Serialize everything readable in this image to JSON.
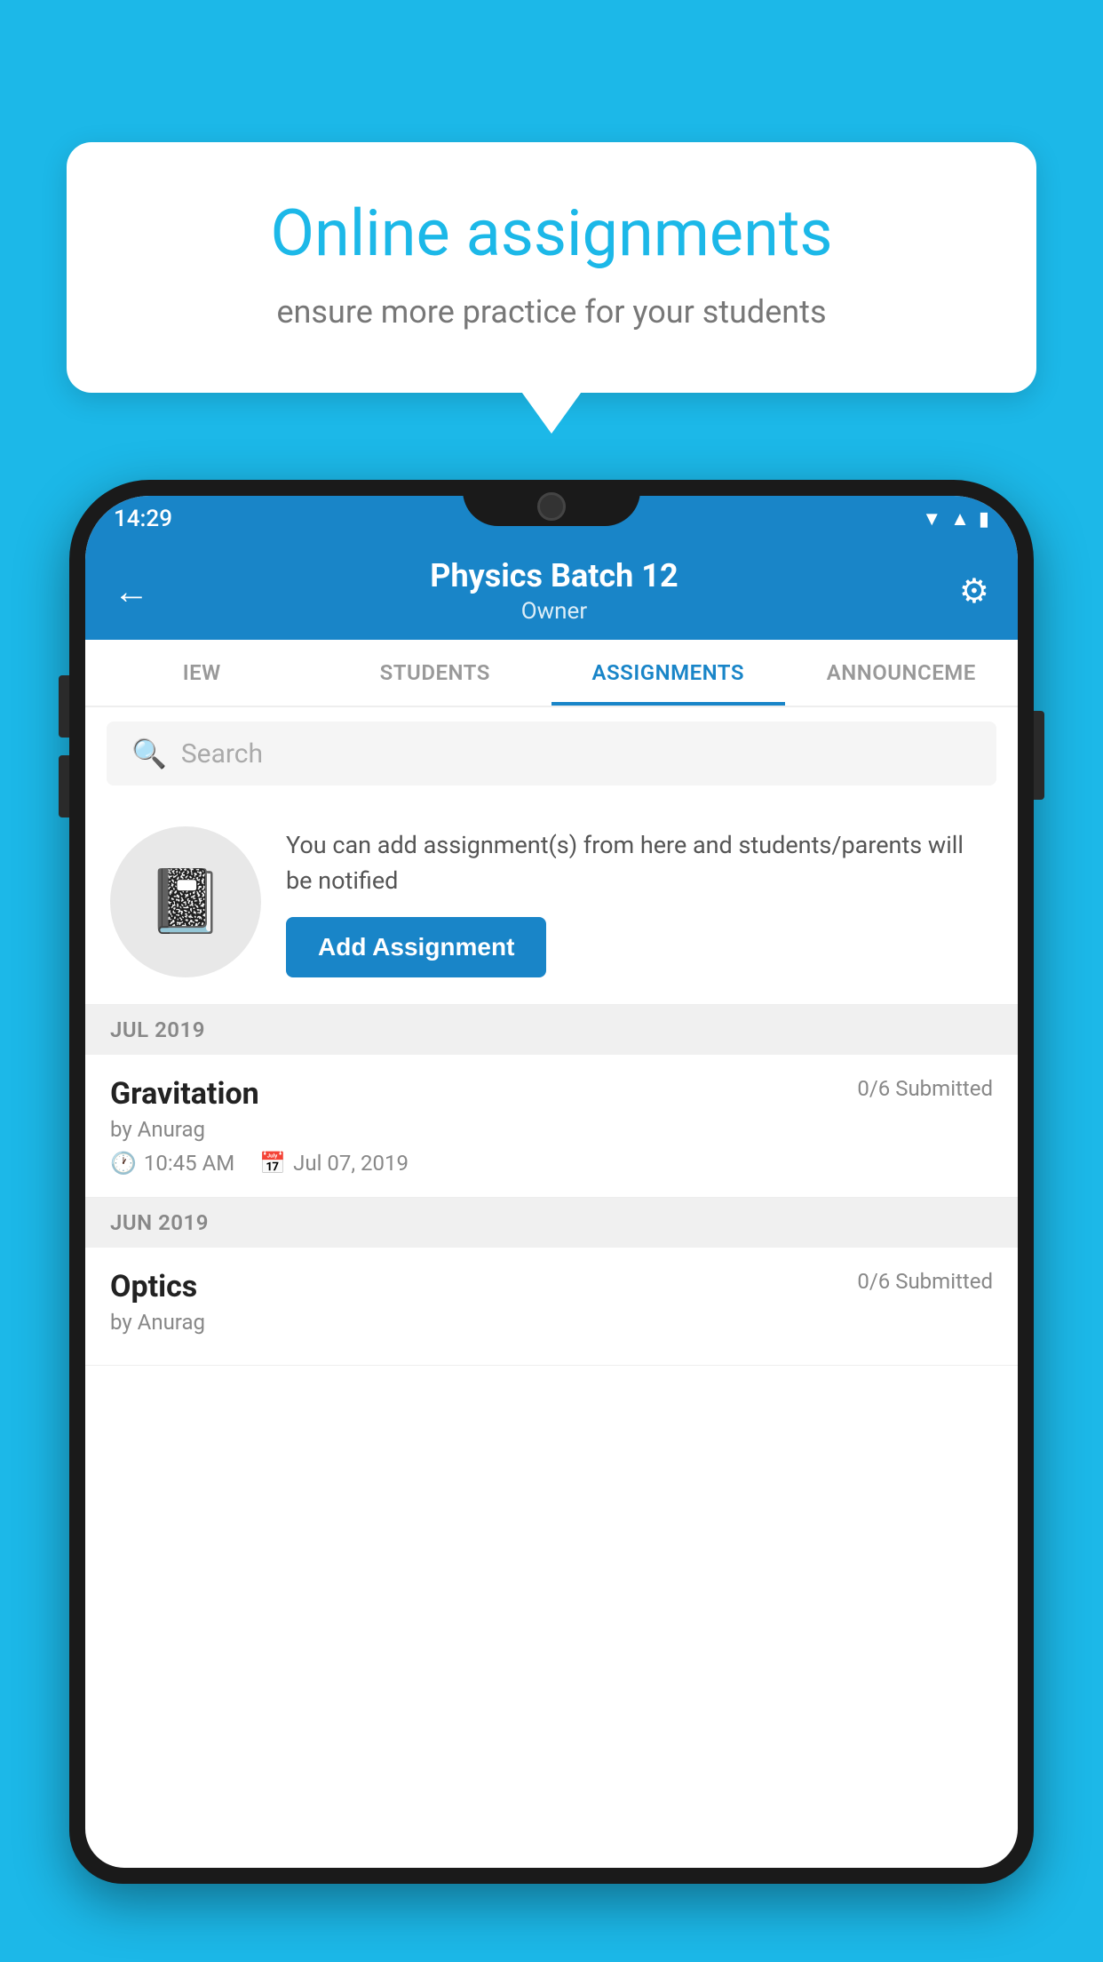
{
  "background": {
    "color": "#1cb8e8"
  },
  "tooltip": {
    "title": "Online assignments",
    "subtitle": "ensure more practice for your students"
  },
  "phone": {
    "statusBar": {
      "time": "14:29",
      "icons": [
        "wifi",
        "signal",
        "battery"
      ]
    },
    "header": {
      "title": "Physics Batch 12",
      "subtitle": "Owner",
      "backLabel": "←",
      "gearLabel": "⚙"
    },
    "tabs": [
      {
        "label": "IEW",
        "active": false
      },
      {
        "label": "STUDENTS",
        "active": false
      },
      {
        "label": "ASSIGNMENTS",
        "active": true
      },
      {
        "label": "ANNOUNCEME",
        "active": false
      }
    ],
    "search": {
      "placeholder": "Search"
    },
    "promo": {
      "text": "You can add assignment(s) from here and students/parents will be notified",
      "addButtonLabel": "Add Assignment"
    },
    "sections": [
      {
        "label": "JUL 2019",
        "assignments": [
          {
            "name": "Gravitation",
            "submitted": "0/6 Submitted",
            "by": "by Anurag",
            "time": "10:45 AM",
            "date": "Jul 07, 2019"
          }
        ]
      },
      {
        "label": "JUN 2019",
        "assignments": [
          {
            "name": "Optics",
            "submitted": "0/6 Submitted",
            "by": "by Anurag",
            "time": "",
            "date": ""
          }
        ]
      }
    ]
  }
}
